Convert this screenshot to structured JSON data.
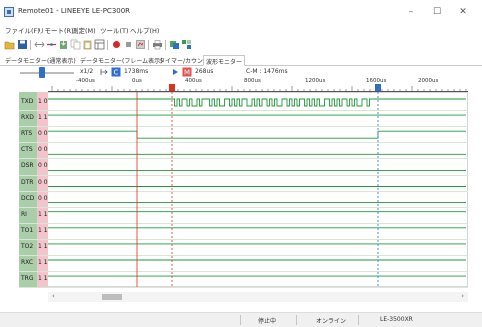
{
  "window": {
    "title": "Remote01 - LINEEYE LE-PC300R",
    "min_glyph": "–",
    "max_glyph": "☐",
    "close_glyph": "✕"
  },
  "menu": [
    "ファイル(F)",
    "リモート(R)",
    "測定(M)",
    "ツール(T)",
    "ヘルプ(H)"
  ],
  "tabs": [
    "データモニター(通常表示)",
    "データモニター(フレーム表示)",
    "タイマー/カウンタ",
    "波形モニター"
  ],
  "active_tab": 3,
  "controls": {
    "zoom": "x1/2",
    "cursor_t1": "1738ms",
    "cursor_t2": "268us",
    "cm": "C-M : 1476ms"
  },
  "ruler_labels": [
    "-400us",
    "0us",
    "400us",
    "800us",
    "1200us",
    "1600us",
    "2000us"
  ],
  "signals": [
    {
      "name": "TXD",
      "level": "1 0"
    },
    {
      "name": "RXD",
      "level": "1 1"
    },
    {
      "name": "RTS",
      "level": "0 0"
    },
    {
      "name": "CTS",
      "level": "0 0"
    },
    {
      "name": "DSR",
      "level": "0 0"
    },
    {
      "name": "DTR",
      "level": "0 0"
    },
    {
      "name": "DCD",
      "level": "0 0"
    },
    {
      "name": "RI",
      "level": "1 1"
    },
    {
      "name": "TO1",
      "level": "1 1"
    },
    {
      "name": "TO2",
      "level": "1 1"
    },
    {
      "name": "RXC",
      "level": "1 1"
    },
    {
      "name": "TRG",
      "level": "1 1"
    }
  ],
  "scroll": {
    "left": "‹",
    "right": "›"
  },
  "status": {
    "mode": "停止中",
    "connection": "オンライン",
    "device": "LE-3500XR"
  },
  "colors": {
    "signal_line": "#1e9a3a",
    "marker_red": "#e0301e",
    "marker_blue": "#2f6fc7",
    "label_bg": "#a9cfa9",
    "level_bg": "#f2c4cb"
  }
}
